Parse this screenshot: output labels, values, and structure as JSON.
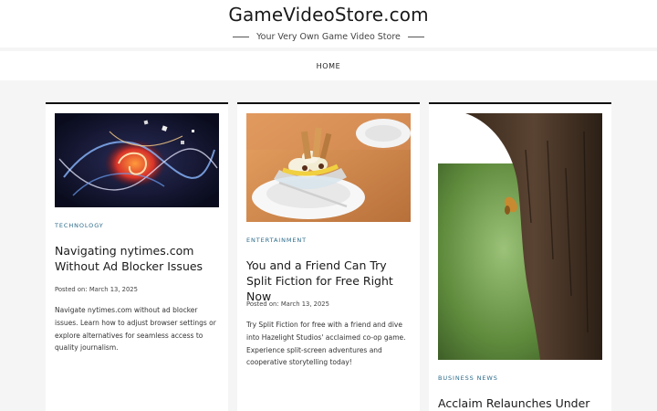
{
  "site": {
    "title": "GameVideoStore.com",
    "tagline": "Your Very Own Game Video Store"
  },
  "nav": {
    "items": [
      {
        "label": "HOME"
      }
    ]
  },
  "posts": [
    {
      "category": "TECHNOLOGY",
      "title": "Navigating nytimes.com Without Ad Blocker Issues",
      "posted_label": "Posted on:",
      "date": "March 13, 2025",
      "excerpt": "Navigate nytimes.com without ad blocker issues. Learn how to adjust browser settings or explore alternatives for seamless access to quality journalism.",
      "image": "abstract-swirl-artwork"
    },
    {
      "category": "ENTERTAINMENT",
      "title": "You and a Friend Can Try Split Fiction for Free Right Now",
      "posted_label": "Posted on:",
      "date": "March 13, 2025",
      "excerpt": "Try Split Fiction for free with a friend and dive into Hazelight Studios' acclaimed co-op game. Experience split-screen adventures and cooperative storytelling today!",
      "image": "banana-split-dessert"
    },
    {
      "category": "BUSINESS NEWS",
      "title": "Acclaim Relaunches Under CEO",
      "image": "tree-trunk-with-cicada"
    }
  ],
  "colors": {
    "category": "#2a6a8a",
    "border": "#111111",
    "background": "#f5f5f5"
  }
}
